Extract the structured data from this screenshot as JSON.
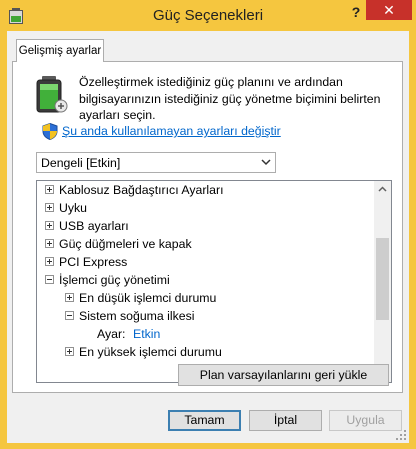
{
  "window": {
    "title": "Güç Seçenekleri",
    "help_label": "?",
    "close_label": "✕"
  },
  "tab": {
    "label": "Gelişmiş ayarlar"
  },
  "description": "Özelleştirmek istediğiniz güç planını ve ardından bilgisayarınızın istediğiniz güç yönetme biçimini belirten ayarları seçin.",
  "link": {
    "label": "Şu anda kullanılamayan ayarları değiştir"
  },
  "plan_select": {
    "value": "Dengeli [Etkin]"
  },
  "tree": {
    "items": [
      {
        "label": "Kablosuz Bağdaştırıcı Ayarları",
        "toggle": "+"
      },
      {
        "label": "Uyku",
        "toggle": "+"
      },
      {
        "label": "USB ayarları",
        "toggle": "+"
      },
      {
        "label": "Güç düğmeleri ve kapak",
        "toggle": "+"
      },
      {
        "label": "PCI Express",
        "toggle": "+"
      },
      {
        "label": "İşlemci güç yönetimi",
        "toggle": "−"
      },
      {
        "label": "En düşük işlemci durumu",
        "toggle": "+"
      },
      {
        "label": "Sistem soğuma ilkesi",
        "toggle": "−"
      },
      {
        "label": "Ayar:",
        "value": "Etkin"
      },
      {
        "label": "En yüksek işlemci durumu",
        "toggle": "+"
      }
    ]
  },
  "restore_button": {
    "label": "Plan varsayılanlarını geri yükle"
  },
  "buttons": {
    "ok": "Tamam",
    "cancel": "İptal",
    "apply": "Uygula"
  },
  "colors": {
    "title_bar": "#f5c63f",
    "close_button": "#c7312a",
    "link": "#0066cc"
  }
}
